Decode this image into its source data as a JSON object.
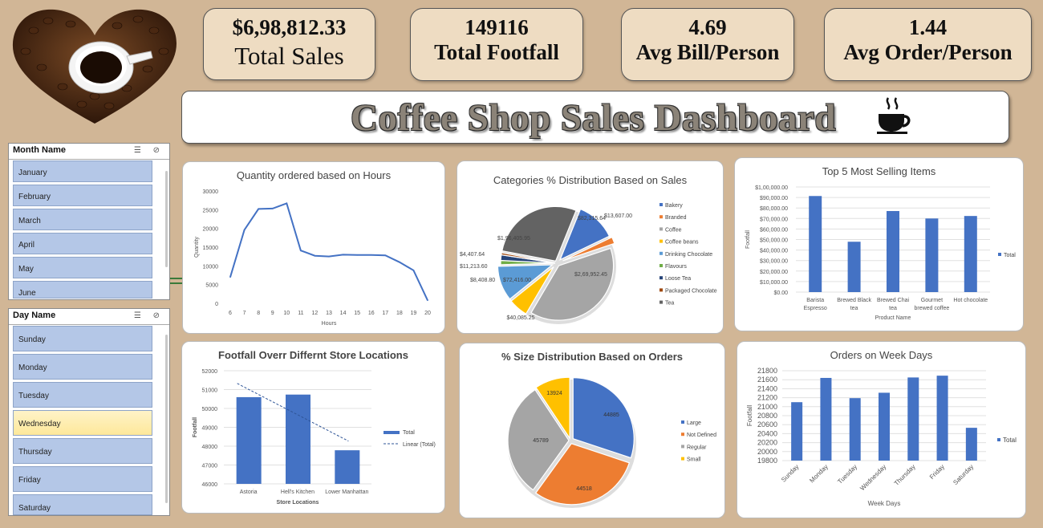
{
  "kpis": {
    "total_sales": {
      "value": "$6,98,812.33",
      "label": "Total Sales"
    },
    "total_footfall": {
      "value": "149116",
      "label": "Total Footfall"
    },
    "avg_bill": {
      "value": "4.69",
      "label": "Avg Bill/Person"
    },
    "avg_order": {
      "value": "1.44",
      "label": "Avg Order/Person"
    }
  },
  "dashboard_title": "Coffee Shop Sales Dashboard",
  "slicers": {
    "month": {
      "title": "Month Name",
      "items": [
        "January",
        "February",
        "March",
        "April",
        "May",
        "June"
      ]
    },
    "day": {
      "title": "Day Name",
      "items": [
        "Sunday",
        "Monday",
        "Tuesday",
        "Wednesday",
        "Thursday",
        "Friday",
        "Saturday"
      ],
      "selected": "Wednesday"
    }
  },
  "chart_data": [
    {
      "type": "line",
      "title": "Quantity ordered based on Hours",
      "xlabel": "Hours",
      "ylabel": "Quantity",
      "x": [
        6,
        7,
        8,
        9,
        10,
        11,
        12,
        13,
        14,
        15,
        16,
        17,
        18,
        19,
        20
      ],
      "y": [
        7000,
        19600,
        25200,
        25300,
        26700,
        14100,
        12700,
        12500,
        13000,
        12900,
        12900,
        12800,
        11000,
        8800,
        800
      ],
      "ylim": [
        0,
        30000
      ],
      "yticks": [
        "0",
        "5000",
        "10000",
        "15000",
        "20000",
        "25000",
        "30000"
      ],
      "color": "#4472c4"
    },
    {
      "type": "pie",
      "title": "Categories % Distribution Based on Sales",
      "slices": [
        {
          "name": "Bakery",
          "value": 82315.64,
          "label": "$82,315.64",
          "color": "#4472c4"
        },
        {
          "name": "Branded",
          "value": 13607.0,
          "label": "$13,607.00",
          "color": "#ed7d31"
        },
        {
          "name": "Coffee",
          "value": 269952.45,
          "label": "$2,69,952.45",
          "color": "#a5a5a5"
        },
        {
          "name": "Coffee beans",
          "value": 40085.25,
          "label": "$40,085.25",
          "color": "#ffc000"
        },
        {
          "name": "Drinking Chocolate",
          "value": 72416.0,
          "label": "$72,416.00",
          "color": "#5b9bd5"
        },
        {
          "name": "Flavours",
          "value": 8408.8,
          "label": "$8,408.80",
          "color": "#70ad47"
        },
        {
          "name": "Loose Tea",
          "value": 11213.6,
          "label": "$11,213.60",
          "color": "#264478"
        },
        {
          "name": "Packaged Chocolate",
          "value": 4407.64,
          "label": "$4,407.64",
          "color": "#9e480e"
        },
        {
          "name": "Tea",
          "value": 196405.95,
          "label": "$1,96,405.95",
          "color": "#636363"
        }
      ]
    },
    {
      "type": "bar",
      "title": "Top 5 Most Selling Items",
      "xlabel": "Product Name",
      "ylabel": "Footfall",
      "categories": [
        "Barista Espresso",
        "Brewed Black tea",
        "Brewed Chai tea",
        "Gourmet brewed coffee",
        "Hot chocolate"
      ],
      "series": [
        {
          "name": "Total",
          "values": [
            91400,
            47900,
            77100,
            70000,
            72400
          ],
          "color": "#4472c4"
        }
      ],
      "ylim": [
        0,
        100000
      ],
      "yticks": [
        "$0.00",
        "$10,000.00",
        "$20,000.00",
        "$30,000.00",
        "$40,000.00",
        "$50,000.00",
        "$60,000.00",
        "$70,000.00",
        "$80,000.00",
        "$90,000.00",
        "$1,00,000.00"
      ]
    },
    {
      "type": "bar",
      "title": "Footfall Overr Differnt Store Locations",
      "xlabel": "Store Locations",
      "ylabel": "Footfall",
      "categories": [
        "Astoria",
        "Hell's Kitchen",
        "Lower Manhattan"
      ],
      "series": [
        {
          "name": "Total",
          "values": [
            50599,
            50735,
            47782
          ],
          "color": "#4472c4"
        }
      ],
      "trendline": {
        "name": "Linear (Total)"
      },
      "ylim": [
        46000,
        52000
      ],
      "yticks": [
        "46000",
        "47000",
        "48000",
        "49000",
        "50000",
        "51000",
        "52000"
      ]
    },
    {
      "type": "pie",
      "title": "% Size Distribution Based on Orders",
      "slices": [
        {
          "name": "Large",
          "value": 44885,
          "label": "44885",
          "color": "#4472c4"
        },
        {
          "name": "Not Defined",
          "value": 44518,
          "label": "44518",
          "color": "#ed7d31"
        },
        {
          "name": "Regular",
          "value": 45789,
          "label": "45789",
          "color": "#a5a5a5"
        },
        {
          "name": "Small",
          "value": 13924,
          "label": "13924",
          "color": "#ffc000"
        }
      ]
    },
    {
      "type": "bar",
      "title": "Orders on Week Days",
      "xlabel": "Week Days",
      "ylabel": "Footfall",
      "categories": [
        "Sunday",
        "Monday",
        "Tuesday",
        "Wednesday",
        "Thursday",
        "Friday",
        "Saturday"
      ],
      "series": [
        {
          "name": "Total",
          "values": [
            21100,
            21640,
            21190,
            21310,
            21650,
            21690,
            20530
          ],
          "color": "#4472c4"
        }
      ],
      "ylim": [
        19800,
        21800
      ],
      "yticks": [
        "19800",
        "20000",
        "20200",
        "20400",
        "20600",
        "20800",
        "21000",
        "21200",
        "21400",
        "21600",
        "21800"
      ]
    }
  ]
}
